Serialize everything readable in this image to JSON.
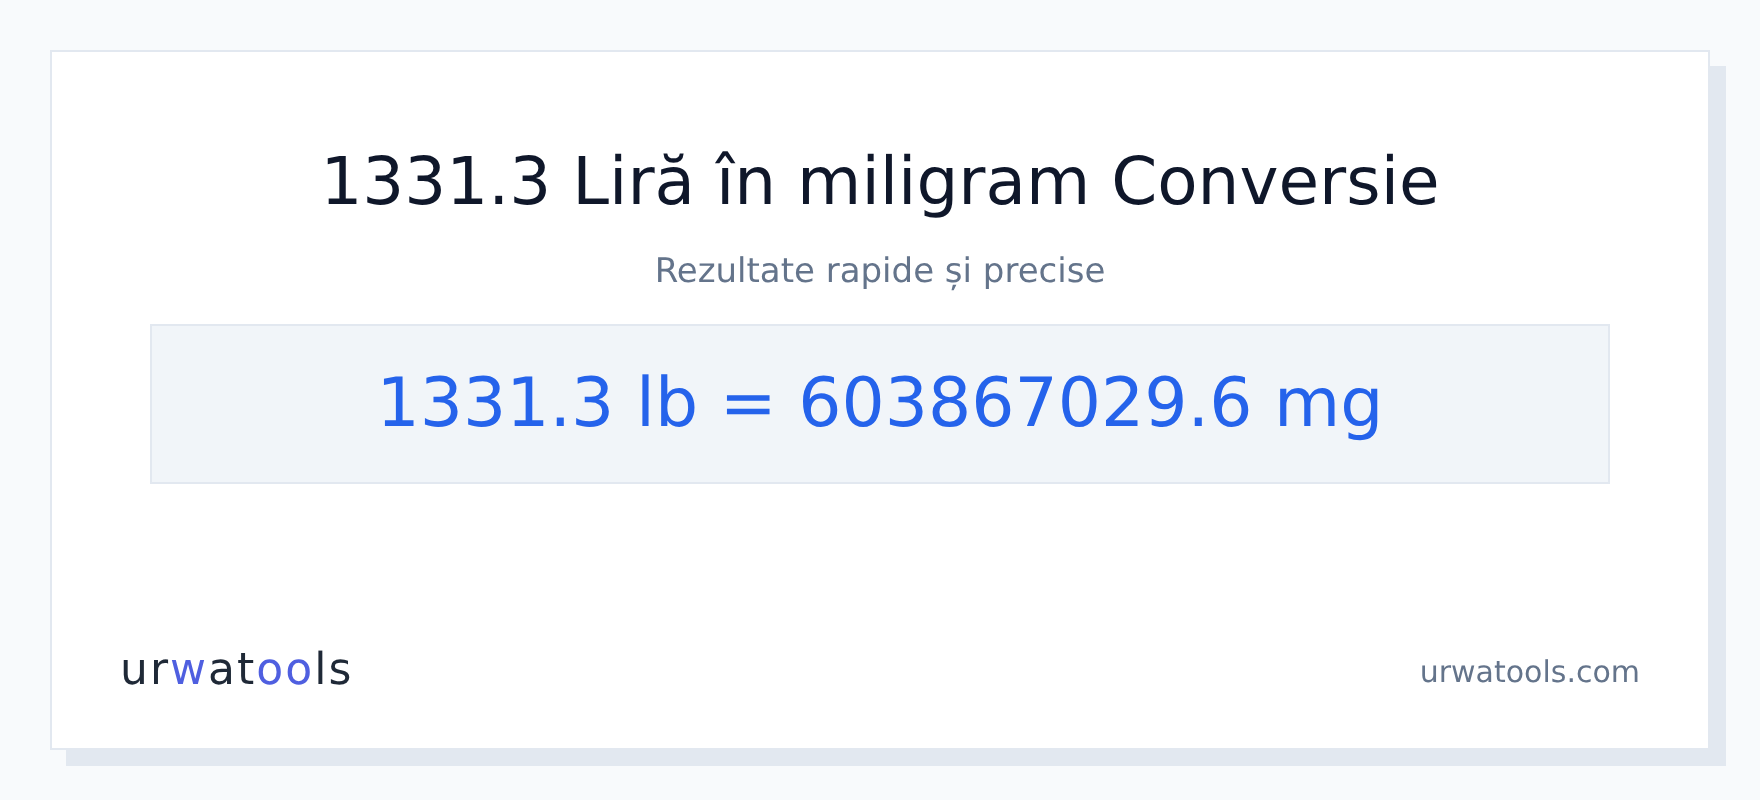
{
  "title": "1331.3 Liră în miligram Conversie",
  "subtitle": "Rezultate rapide și precise",
  "result": "1331.3 lb = 603867029.6 mg",
  "logo": "urwatools",
  "site": "urwatools.com"
}
